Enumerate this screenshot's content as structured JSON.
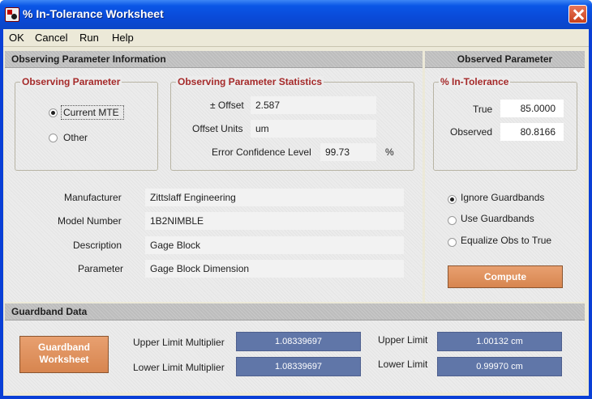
{
  "window": {
    "title": "% In-Tolerance Worksheet"
  },
  "menu": {
    "items": [
      "OK",
      "Cancel",
      "Run",
      "Help"
    ]
  },
  "obs_param_info": {
    "header": "Observing Parameter Information",
    "observing_parameter": {
      "title": "Observing Parameter",
      "options": [
        "Current MTE",
        "Other"
      ],
      "selected": "Current MTE"
    },
    "statistics": {
      "title": "Observing Parameter Statistics",
      "offset_label": "± Offset",
      "offset_value": "2.587",
      "units_label": "Offset Units",
      "units_value": "um",
      "conf_label": "Error Confidence Level",
      "conf_value": "99.73",
      "conf_unit": "%"
    },
    "details": {
      "manufacturer_label": "Manufacturer",
      "manufacturer_value": "Zittslaff Engineering",
      "model_label": "Model Number",
      "model_value": "1B2NIMBLE",
      "description_label": "Description",
      "description_value": "Gage Block",
      "parameter_label": "Parameter",
      "parameter_value": "Gage Block Dimension"
    }
  },
  "observed_param": {
    "header": "Observed Parameter",
    "in_tolerance": {
      "title": "% In-Tolerance",
      "true_label": "True",
      "true_value": "85.0000",
      "observed_label": "Observed",
      "observed_value": "80.8166"
    },
    "guardband_options": [
      "Ignore Guardbands",
      "Use Guardbands",
      "Equalize Obs to True"
    ],
    "guardband_selected": "Ignore Guardbands",
    "compute_label": "Compute"
  },
  "guardband": {
    "header": "Guardband Data",
    "button_line1": "Guardband",
    "button_line2": "Worksheet",
    "upper_mult_label": "Upper Limit Multiplier",
    "upper_mult_value": "1.08339697",
    "lower_mult_label": "Lower Limit Multiplier",
    "lower_mult_value": "1.08339697",
    "upper_limit_label": "Upper Limit",
    "upper_limit_value": "1.00132 cm",
    "lower_limit_label": "Lower Limit",
    "lower_limit_value": "0.99970 cm"
  }
}
